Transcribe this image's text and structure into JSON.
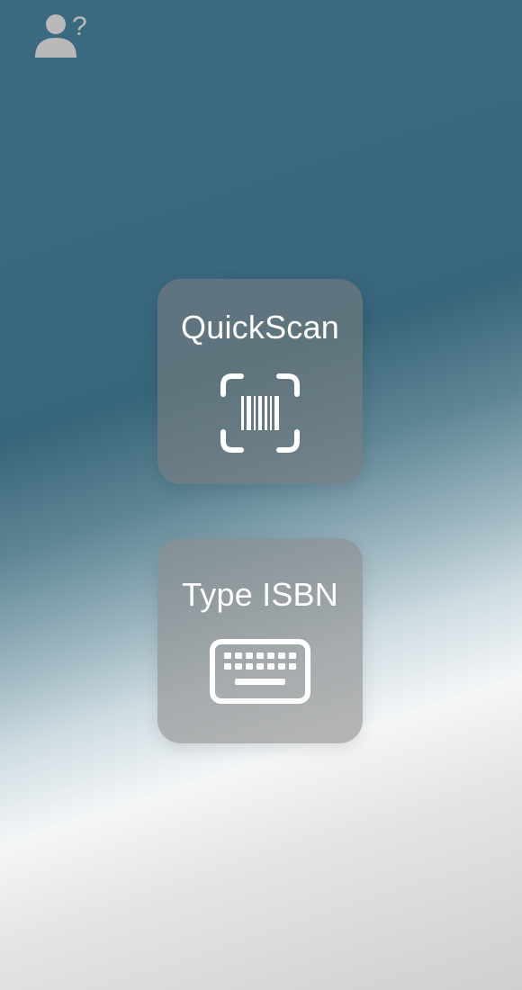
{
  "header": {
    "account_icon": "person-question-icon"
  },
  "actions": [
    {
      "label": "QuickScan",
      "icon": "barcode-scan-icon"
    },
    {
      "label": "Type ISBN",
      "icon": "keyboard-icon"
    }
  ],
  "colors": {
    "tile_text": "#ffffff",
    "icon_gray": "#b9b9b9"
  }
}
